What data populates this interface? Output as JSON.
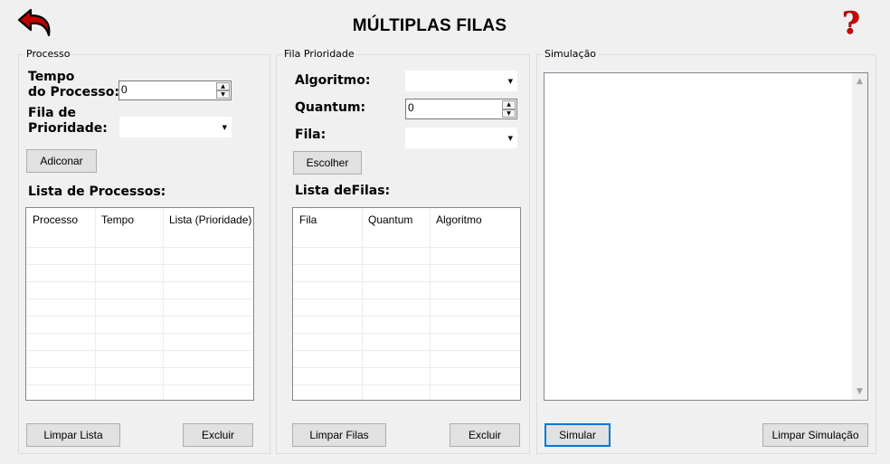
{
  "header": {
    "title": "MÚLTIPLAS FILAS",
    "back_icon": "back-arrow-icon",
    "help_icon": "question-mark-icon",
    "back_color": "#c00000",
    "help_color": "#d40000"
  },
  "processo": {
    "legend": "Processo",
    "tempo_label_1": "Tempo",
    "tempo_label_2": "do Processo:",
    "tempo_value": "0",
    "fila_label_1": "Fila de",
    "fila_label_2": "Prioridade:",
    "add_button": "Adiconar",
    "list_title": "Lista de Processos:",
    "columns": [
      "Processo",
      "Tempo",
      "Lista (Prioridade)"
    ],
    "clear_button": "Limpar Lista",
    "delete_button": "Excluir"
  },
  "fila": {
    "legend": "Fila Prioridade",
    "algoritmo_label": "Algoritmo:",
    "quantum_label": "Quantum:",
    "quantum_value": "0",
    "fila_label": "Fila:",
    "choose_button": "Escolher",
    "list_title": "Lista deFilas:",
    "columns": [
      "Fila",
      "Quantum",
      "Algoritmo"
    ],
    "clear_button": "Limpar Filas",
    "delete_button": "Excluir"
  },
  "simulacao": {
    "legend": "Simulação",
    "simulate_button": "Simular",
    "clear_button": "Limpar Simulação"
  }
}
